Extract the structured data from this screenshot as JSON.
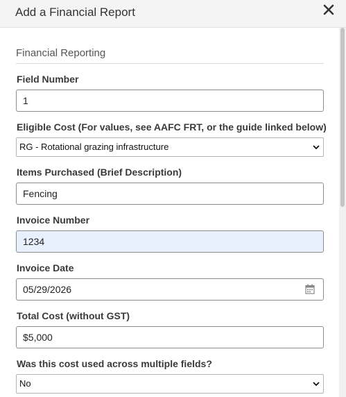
{
  "dialog": {
    "title": "Add a Financial Report"
  },
  "section": {
    "title": "Financial Reporting"
  },
  "fields": {
    "field_number": {
      "label": "Field Number",
      "value": "1"
    },
    "eligible_cost": {
      "label": "Eligible Cost (For values, see AAFC FRT, or the guide linked below)",
      "value": "RG - Rotational grazing infrastructure"
    },
    "items_purchased": {
      "label": "Items Purchased (Brief Description)",
      "value": "Fencing"
    },
    "invoice_number": {
      "label": "Invoice Number",
      "value": "1234"
    },
    "invoice_date": {
      "label": "Invoice Date",
      "value": "05/29/2026"
    },
    "total_cost": {
      "label": "Total Cost (without GST)",
      "value": "$5,000"
    },
    "multiple_fields": {
      "label": "Was this cost used across multiple fields?",
      "value": "No"
    }
  },
  "icons": {
    "close": "close-icon",
    "calendar": "calendar-icon",
    "dropdown": "chevron-down-icon"
  }
}
